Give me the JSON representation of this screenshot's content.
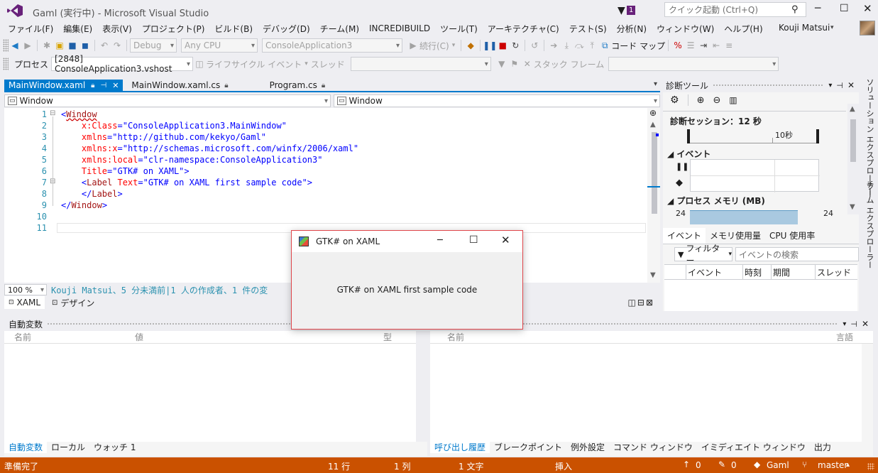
{
  "window": {
    "title": "Gaml (実行中) - Microsoft Visual Studio",
    "notification_count": "1",
    "quick_launch_placeholder": "クイック起動 (Ctrl+Q)"
  },
  "menu": [
    "ファイル(F)",
    "編集(E)",
    "表示(V)",
    "プロジェクト(P)",
    "ビルド(B)",
    "デバッグ(D)",
    "チーム(M)",
    "INCREDIBUILD",
    "ツール(T)",
    "アーキテクチャ(C)",
    "テスト(S)",
    "分析(N)",
    "ウィンドウ(W)",
    "ヘルプ(H)"
  ],
  "user": {
    "name": "Kouji Matsui"
  },
  "toolbar": {
    "config": "Debug",
    "platform": "Any CPU",
    "startup_project": "ConsoleApplication3",
    "continue_label": "続行(C)",
    "codemap_label": "コード マップ"
  },
  "debug_toolbar": {
    "process_label": "プロセス",
    "process_value": "[2848] ConsoleApplication3.vshost",
    "lifecycle_label": "ライフサイクル イベント",
    "thread_label": "スレッド",
    "stackframe_label": "スタック フレーム"
  },
  "doc_tabs": [
    {
      "label": "MainWindow.xaml",
      "active": true
    },
    {
      "label": "MainWindow.xaml.cs",
      "active": false
    },
    {
      "label": "Program.cs",
      "active": false
    }
  ],
  "nav": {
    "left": "Window",
    "right": "Window"
  },
  "editor": {
    "line_numbers": [
      "1",
      "2",
      "3",
      "4",
      "5",
      "6",
      "7",
      "8",
      "9",
      "10",
      "11"
    ],
    "lines": [
      [
        {
          "t": "<",
          "c": "br"
        },
        {
          "t": "Window",
          "c": "tag"
        }
      ],
      [
        {
          "t": "    x:Class",
          "c": "attr"
        },
        {
          "t": "=",
          "c": "br"
        },
        {
          "t": "\"ConsoleApplication3.MainWindow\"",
          "c": "val"
        }
      ],
      [
        {
          "t": "    xmlns",
          "c": "attr"
        },
        {
          "t": "=",
          "c": "br"
        },
        {
          "t": "\"http://github.com/kekyo/Gaml\"",
          "c": "val"
        }
      ],
      [
        {
          "t": "    xmlns:x",
          "c": "attr"
        },
        {
          "t": "=",
          "c": "br"
        },
        {
          "t": "\"http://schemas.microsoft.com/winfx/2006/xaml\"",
          "c": "val"
        }
      ],
      [
        {
          "t": "    xmlns:local",
          "c": "attr"
        },
        {
          "t": "=",
          "c": "br"
        },
        {
          "t": "\"clr-namespace:ConsoleApplication3\"",
          "c": "val"
        }
      ],
      [
        {
          "t": "    Title",
          "c": "attr"
        },
        {
          "t": "=",
          "c": "br"
        },
        {
          "t": "\"GTK# on XAML\"",
          "c": "val"
        },
        {
          "t": ">",
          "c": "br"
        }
      ],
      [
        {
          "t": "    <",
          "c": "br"
        },
        {
          "t": "Label",
          "c": "tag"
        },
        {
          "t": " Text",
          "c": "attr"
        },
        {
          "t": "=",
          "c": "br"
        },
        {
          "t": "\"GTK# on XAML first sample code\"",
          "c": "val"
        },
        {
          "t": ">",
          "c": "br"
        }
      ],
      [
        {
          "t": "    </",
          "c": "br"
        },
        {
          "t": "Label",
          "c": "tag"
        },
        {
          "t": ">",
          "c": "br"
        }
      ],
      [
        {
          "t": "</",
          "c": "br"
        },
        {
          "t": "Window",
          "c": "tag"
        },
        {
          "t": ">",
          "c": "br"
        }
      ],
      [],
      []
    ],
    "zoom": "100 %",
    "codelens": "Kouji Matsui、5 分未満前|1 人の作成者、1 件の変"
  },
  "view_tabs": {
    "xaml": "XAML",
    "design": "デザイン"
  },
  "autos": {
    "title": "自動変数",
    "col_name": "名前",
    "col_value": "値",
    "col_type": "型",
    "tabs": [
      "自動変数",
      "ローカル",
      "ウォッチ 1"
    ]
  },
  "callstack": {
    "col_name": "名前",
    "col_lang": "言語",
    "tabs": [
      "呼び出し履歴",
      "ブレークポイント",
      "例外設定",
      "コマンド ウィンドウ",
      "イミディエイト ウィンドウ",
      "出力"
    ]
  },
  "diag": {
    "title": "診断ツール",
    "session": "診断セッション：12 秒",
    "timeline_label": "10秒",
    "events_section": "イベント",
    "memory_section": "プロセス メモリ (MB)",
    "mem_left": "24",
    "mem_right": "24",
    "tabs": [
      "イベント",
      "メモリ使用量",
      "CPU 使用率"
    ],
    "filter": "フィルター",
    "search_placeholder": "イベントの検索",
    "columns": [
      "イベント",
      "時刻",
      "期間",
      "スレッド"
    ]
  },
  "side_tabs": [
    "ソリューション エクスプローラー",
    "チーム エクスプローラー"
  ],
  "status": {
    "ready": "準備完了",
    "line": "11 行",
    "col": "1 列",
    "char": "1 文字",
    "mode": "挿入",
    "up": "0",
    "edits": "0",
    "repo": "Gaml",
    "branch": "master"
  },
  "gtk": {
    "title": "GTK# on XAML",
    "label": "GTK# on XAML first sample code"
  },
  "colors": {
    "accent": "#007acc",
    "status_bar": "#ca5100",
    "vs_purple": "#68217a"
  }
}
